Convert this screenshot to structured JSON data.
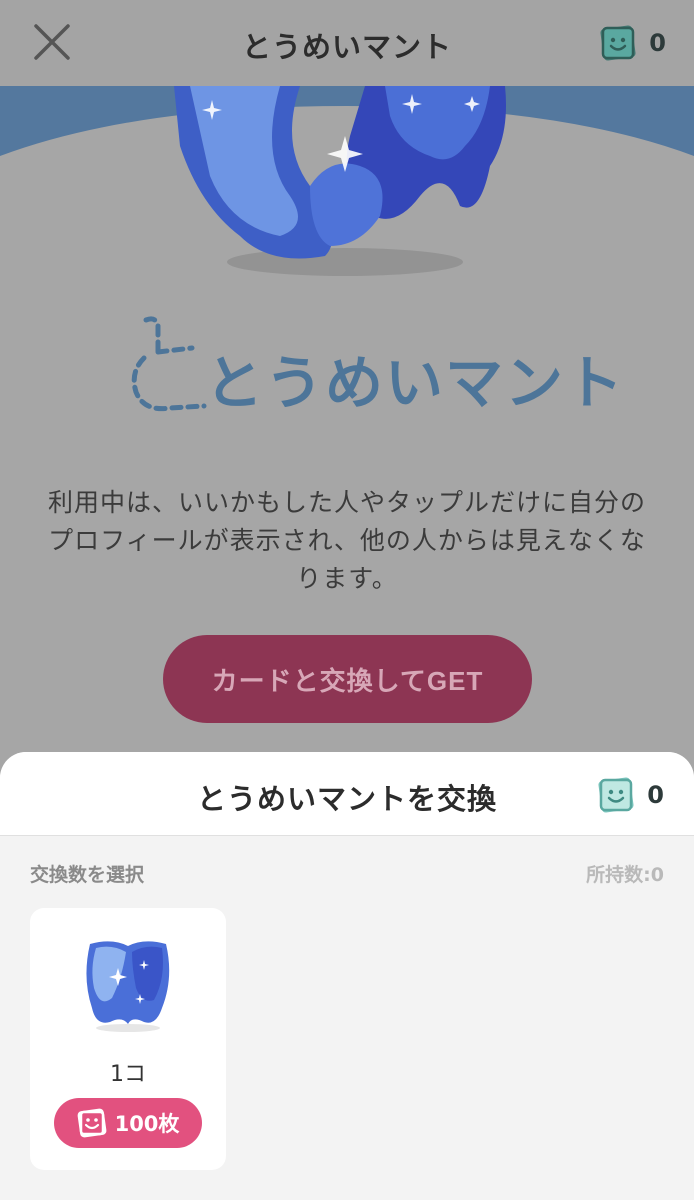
{
  "header": {
    "title": "とうめいマント",
    "card_count": "0"
  },
  "hero": {
    "logo_text": "とうめいマント"
  },
  "description": "利用中は、いいかもした人やタップルだけに自分のプロフィールが表示され、他の人からは見えなくなります。",
  "get_button_label": "カードと交換してGET",
  "sheet": {
    "title": "とうめいマントを交換",
    "card_count": "0",
    "select_label": "交換数を選択",
    "owned_label": "所持数:0",
    "options": [
      {
        "quantity": "1コ",
        "price": "100枚"
      }
    ]
  },
  "colors": {
    "accent_pink": "#e2517f",
    "button_dimmed": "#8d3553",
    "logo_blue": "#4d7599",
    "card_icon_teal": "#5aa8a0"
  }
}
